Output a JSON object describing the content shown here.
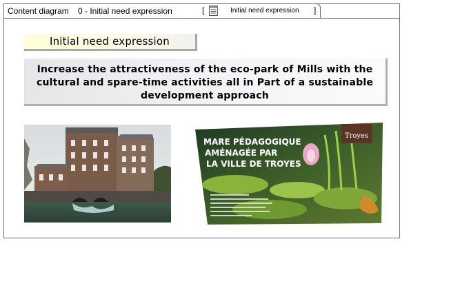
{
  "tab": {
    "type_label": "Content diagram",
    "diagram_name": "0 - Initial need expression",
    "bracket_open": "[",
    "bracket_close": "]",
    "link_label": "Initial need expression",
    "icon": "document-icon"
  },
  "diagram": {
    "title": "Initial need expression",
    "statement": "Increase the attractiveness of the eco-park of Mills with the cultural and spare-time activities all in Part of a sustainable development approach"
  },
  "photos": {
    "left": {
      "subject": "mill-building-photo"
    },
    "right": {
      "subject": "pond-sign-photo",
      "sign_line_1": "MARE PÉDAGOGIQUE",
      "sign_line_2": "AMÉNAGÉE PAR",
      "sign_line_3": "LA VILLE DE TROYES",
      "logo_text": "Troyes"
    }
  },
  "colors": {
    "frame_border": "#6e6e6e",
    "title_fill": "#fefed8",
    "statement_fill": "#eef0f1",
    "shadow": "#a9a9a9"
  }
}
